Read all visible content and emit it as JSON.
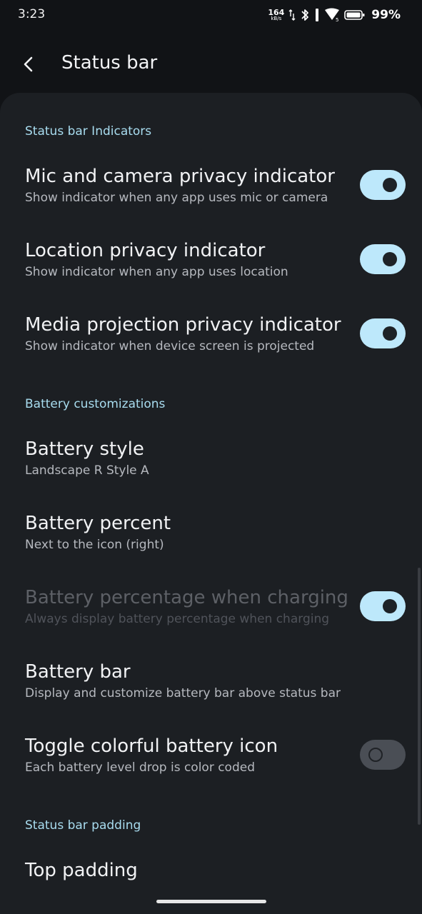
{
  "status_bar": {
    "time": "3:23",
    "net_speed_value": "164",
    "net_speed_unit": "kB/s",
    "battery_percent": "99%",
    "icons": [
      "data-arrows-icon",
      "bluetooth-icon",
      "vibrate-icon",
      "wifi-icon",
      "battery-icon"
    ]
  },
  "toolbar": {
    "title": "Status bar"
  },
  "sections": {
    "indicators": "Status bar Indicators",
    "battery": "Battery customizations",
    "padding": "Status bar padding"
  },
  "items": [
    {
      "title": "Mic and camera privacy indicator",
      "subtitle": "Show indicator when any app uses mic or camera",
      "toggle": true
    },
    {
      "title": "Location privacy indicator",
      "subtitle": "Show indicator when any app uses location",
      "toggle": true
    },
    {
      "title": "Media projection privacy indicator",
      "subtitle": "Show indicator when device screen is projected",
      "toggle": true
    },
    {
      "title": "Battery style",
      "subtitle": "Landscape R Style A"
    },
    {
      "title": "Battery percent",
      "subtitle": "Next to the icon (right)"
    },
    {
      "title": "Battery percentage when charging",
      "subtitle": "Always display battery percentage when charging",
      "toggle": true,
      "disabled": true
    },
    {
      "title": "Battery bar",
      "subtitle": "Display and customize battery bar above status bar"
    },
    {
      "title": "Toggle colorful battery icon",
      "subtitle": "Each battery level drop is color coded",
      "toggle": false
    },
    {
      "title": "Top padding"
    }
  ],
  "colors": {
    "accent": "#a8dcef",
    "switch_on": "#bde8fb",
    "switch_off": "#4a4e55",
    "background": "#1c1f23"
  }
}
